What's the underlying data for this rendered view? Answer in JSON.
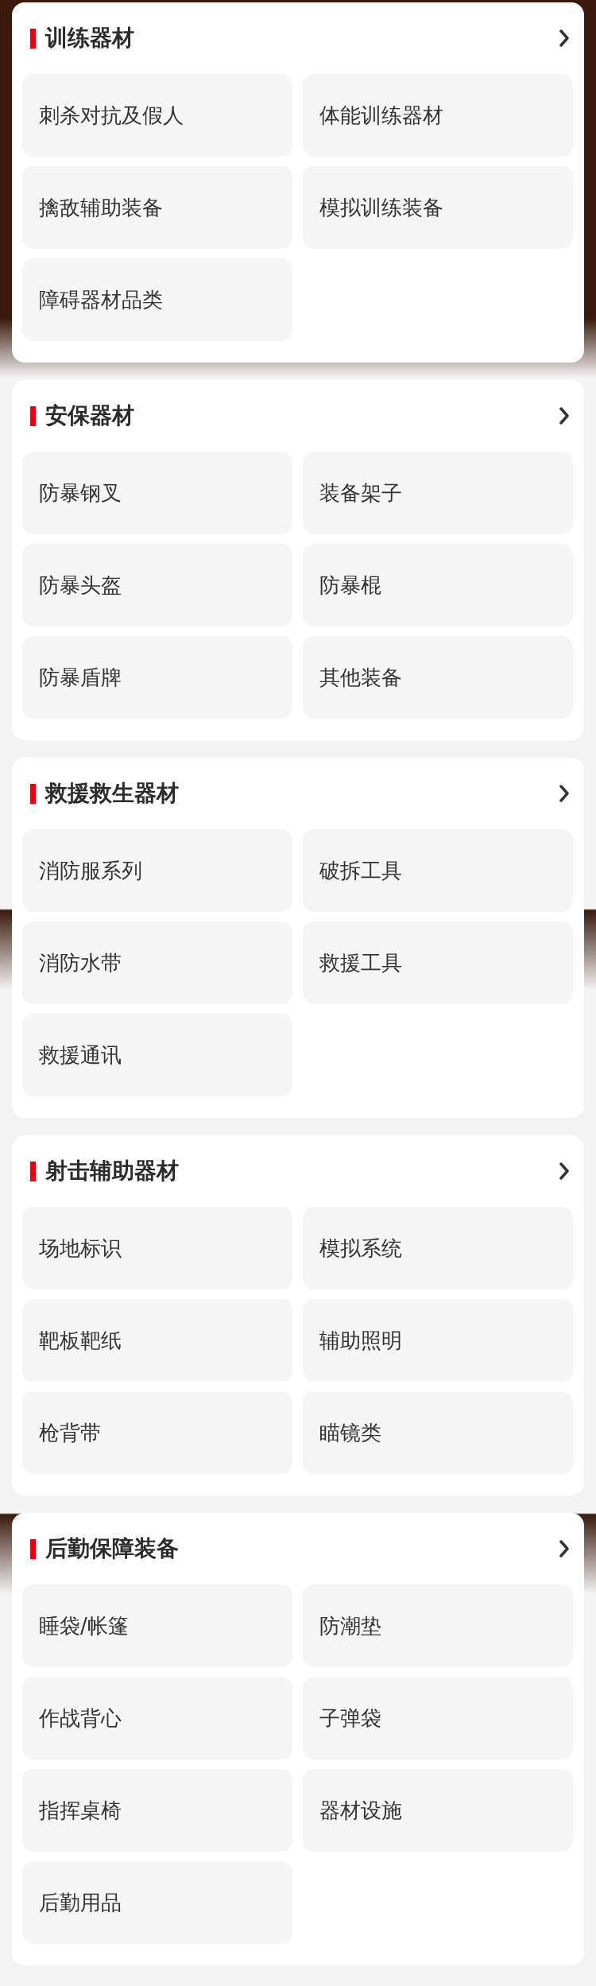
{
  "sections": [
    {
      "title": "训练器材",
      "items": [
        "刺杀对抗及假人",
        "体能训练器材",
        "擒敌辅助装备",
        "模拟训练装备",
        "障碍器材品类"
      ]
    },
    {
      "title": "安保器材",
      "items": [
        "防暴钢叉",
        "装备架子",
        "防暴头盔",
        "防暴棍",
        "防暴盾牌",
        "其他装备"
      ]
    },
    {
      "title": "救援救生器材",
      "items": [
        "消防服系列",
        "破拆工具",
        "消防水带",
        "救援工具",
        "救援通讯"
      ]
    },
    {
      "title": "射击辅助器材",
      "items": [
        "场地标识",
        "模拟系统",
        "靶板靶纸",
        "辅助照明",
        "枪背带",
        "瞄镜类"
      ]
    },
    {
      "title": "后勤保障装备",
      "items": [
        "睡袋/帐篷",
        "防潮垫",
        "作战背心",
        "子弹袋",
        "指挥桌椅",
        "器材设施",
        "后勤用品"
      ]
    }
  ]
}
